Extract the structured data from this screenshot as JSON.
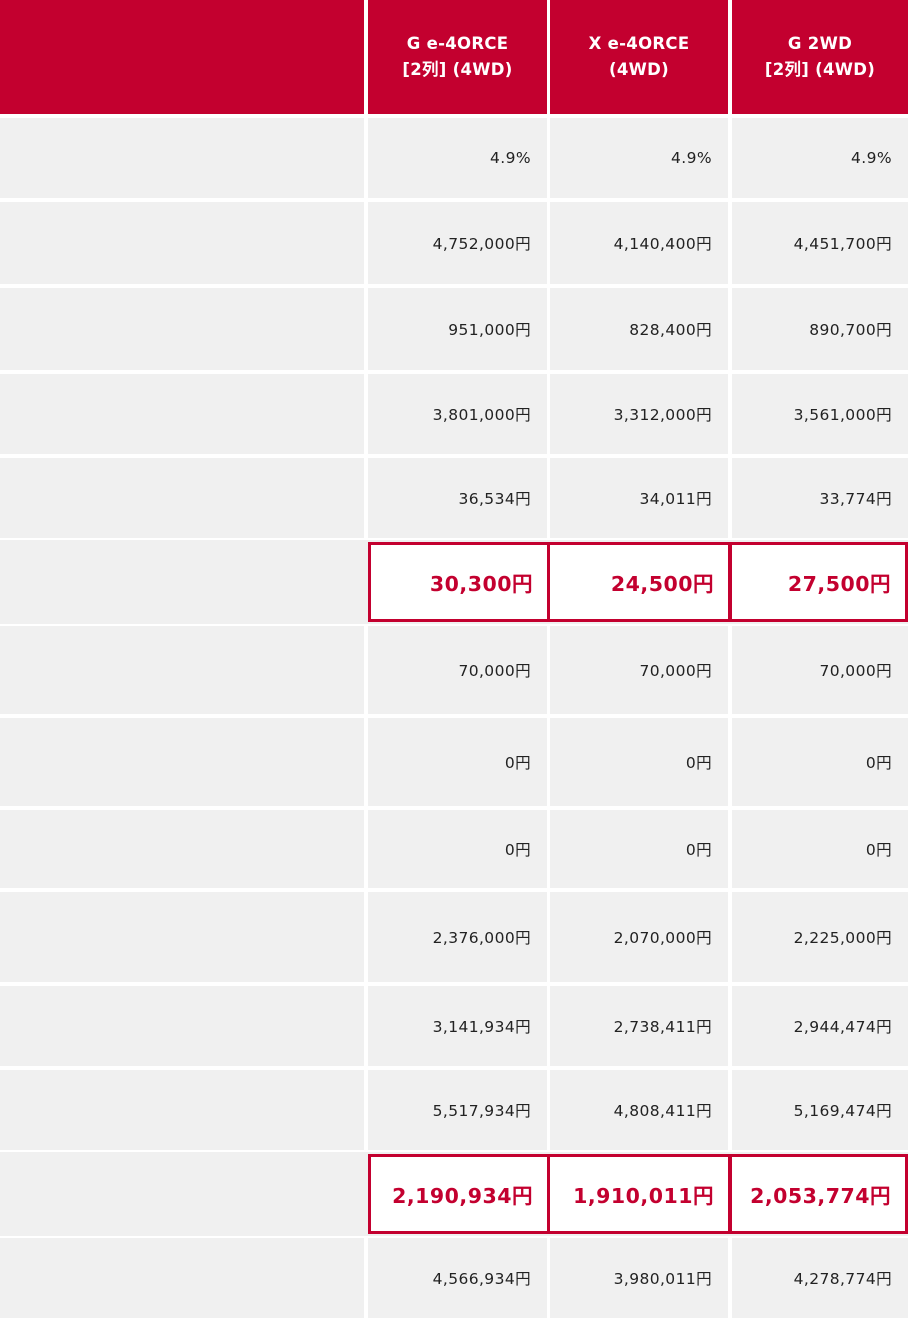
{
  "header": {
    "columns": [
      {
        "line1": "G e-4ORCE",
        "line2": "[2列] (4WD)"
      },
      {
        "line1": "X e-4ORCE",
        "line2": "(4WD)"
      },
      {
        "line1": "G 2WD",
        "line2": "[2列] (4WD)"
      }
    ]
  },
  "rows": [
    {
      "values": [
        "4.9%",
        "4.9%",
        "4.9%"
      ],
      "highlight": false
    },
    {
      "values": [
        "4,752,000円",
        "4,140,400円",
        "4,451,700円"
      ],
      "highlight": false
    },
    {
      "values": [
        "951,000円",
        "828,400円",
        "890,700円"
      ],
      "highlight": false
    },
    {
      "values": [
        "3,801,000円",
        "3,312,000円",
        "3,561,000円"
      ],
      "highlight": false
    },
    {
      "values": [
        "36,534円",
        "34,011円",
        "33,774円"
      ],
      "highlight": false
    },
    {
      "values": [
        "30,300円",
        "24,500円",
        "27,500円"
      ],
      "highlight": true
    },
    {
      "values": [
        "70,000円",
        "70,000円",
        "70,000円"
      ],
      "highlight": false
    },
    {
      "values": [
        "0円",
        "0円",
        "0円"
      ],
      "highlight": false
    },
    {
      "values": [
        "0円",
        "0円",
        "0円"
      ],
      "highlight": false
    },
    {
      "values": [
        "2,376,000円",
        "2,070,000円",
        "2,225,000円"
      ],
      "highlight": false
    },
    {
      "values": [
        "3,141,934円",
        "2,738,411円",
        "2,944,474円"
      ],
      "highlight": false
    },
    {
      "values": [
        "5,517,934円",
        "4,808,411円",
        "5,169,474円"
      ],
      "highlight": false
    },
    {
      "values": [
        "2,190,934円",
        "1,910,011円",
        "2,053,774円"
      ],
      "highlight": true
    },
    {
      "values": [
        "4,566,934円",
        "3,980,011円",
        "4,278,774円"
      ],
      "highlight": false
    }
  ],
  "colors": {
    "accent": "#c3002f",
    "cell_bg": "#f0f0f0",
    "text": "#222222"
  }
}
